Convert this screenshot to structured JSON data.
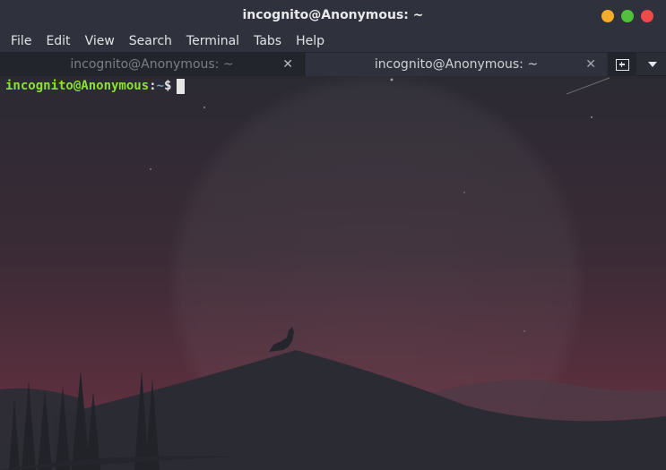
{
  "window": {
    "title": "incognito@Anonymous: ~",
    "controls": [
      {
        "name": "minimize",
        "color": "#f5ac2b"
      },
      {
        "name": "maximize",
        "color": "#51c13d"
      },
      {
        "name": "close",
        "color": "#ee4a4a"
      }
    ]
  },
  "menu": {
    "items": [
      "File",
      "Edit",
      "View",
      "Search",
      "Terminal",
      "Tabs",
      "Help"
    ]
  },
  "tabs": [
    {
      "label": "incognito@Anonymous: ~",
      "close": "✕",
      "active": false
    },
    {
      "label": "incognito@Anonymous: ~",
      "close": "✕",
      "active": true
    }
  ],
  "terminal": {
    "user_host": "incognito@Anonymous",
    "separator": ":",
    "path": "~",
    "symbol": "$",
    "colors": {
      "user_host": "#8ae234",
      "path": "#729fcf",
      "symbol": "#e6e6e6"
    }
  },
  "icons": {
    "new_tab": "new-tab-icon",
    "tab_menu": "chevron-down-icon"
  }
}
